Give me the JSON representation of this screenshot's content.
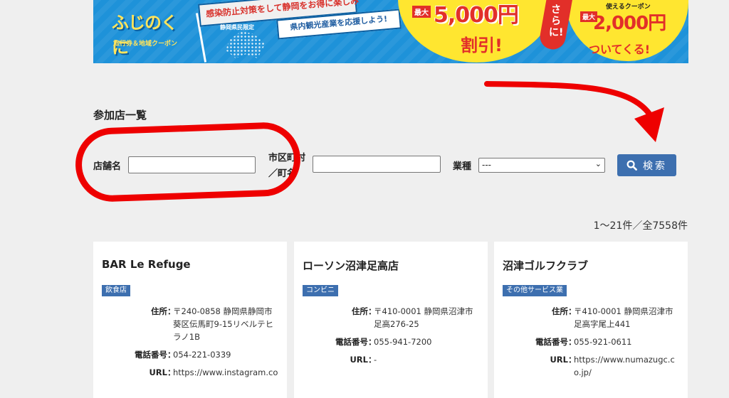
{
  "banner": {
    "logo_text": "ふじのくに",
    "logo_sub": "旅行券＆地域クーポン",
    "flag1_text": "感染防止対策をして静岡をお得に楽しみ",
    "pref_label": "静岡県民限定",
    "flag2_text": "県内観光産業を応援しよう!",
    "max_label_1": "最大",
    "discount_amount": "5,000円",
    "discount_word": "割引!",
    "sarani": "さらに!",
    "coupon_top": "使えるクーポン",
    "max_label_2": "最大",
    "coupon_amount": "2,000円",
    "coupon_word": "ついてくる!"
  },
  "page_title": "参加店一覧",
  "form": {
    "shop_label": "店舗名",
    "shop_value": "",
    "city_label": "市区町村／町名",
    "city_value": "",
    "type_label": "業種",
    "type_selected": "---",
    "search_label": "検索"
  },
  "result_count": "1〜21件／全7558件",
  "cards": [
    {
      "name": "BAR Le Refuge",
      "category": "飲食店",
      "address_label": "住所",
      "address": "〒240-0858 静岡県静岡市葵区伝馬町9-15リベルテヒラノ1B",
      "phone_label": "電話番号",
      "phone": "054-221-0339",
      "url_label": "URL",
      "url": "https://www.instagram.co"
    },
    {
      "name": "ローソン沼津足高店",
      "category": "コンビニ",
      "address_label": "住所",
      "address": "〒410-0001 静岡県沼津市足高276-25",
      "phone_label": "電話番号",
      "phone": "055-941-7200",
      "url_label": "URL",
      "url": "-"
    },
    {
      "name": "沼津ゴルフクラブ",
      "category": "その他サービス業",
      "address_label": "住所",
      "address": "〒410-0001 静岡県沼津市足高字尾上441",
      "phone_label": "電話番号",
      "phone": "055-921-0611",
      "url_label": "URL",
      "url": "https://www.numazugc.co.jp/"
    }
  ],
  "colors": {
    "banner_blue": "#1e92d9",
    "accent_blue": "#3d6faf",
    "highlight_red": "#ee0000",
    "banner_yellow": "#ffe630"
  }
}
